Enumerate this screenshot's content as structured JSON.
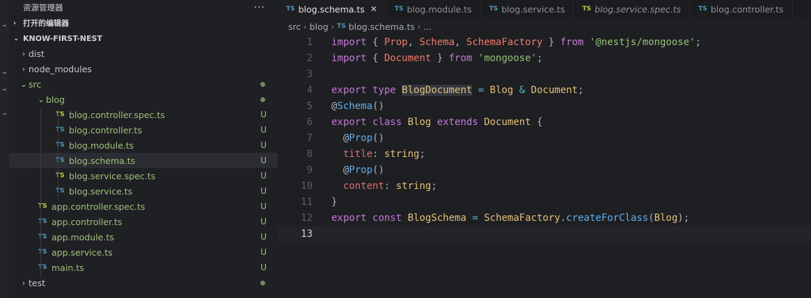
{
  "sidebar": {
    "title": "资源管理器",
    "more": "···",
    "open_editors": "打开的编辑器",
    "project": "KNOW-FIRST-NEST",
    "tree": [
      {
        "label": "dist",
        "type": "folder",
        "chev": "›",
        "depth": 0,
        "style": "plain"
      },
      {
        "label": "node_modules",
        "type": "folder",
        "chev": "›",
        "depth": 0,
        "style": "plain"
      },
      {
        "label": "src",
        "type": "folder",
        "chev": "⌄",
        "depth": 0,
        "style": "green",
        "dot": true
      },
      {
        "label": "blog",
        "type": "folder",
        "chev": "⌄",
        "depth": 1,
        "style": "green",
        "dot": true
      },
      {
        "label": "blog.controller.spec.ts",
        "type": "file",
        "depth": 2,
        "ts": "TS",
        "tsColor": "yellow",
        "git": "U"
      },
      {
        "label": "blog.controller.ts",
        "type": "file",
        "depth": 2,
        "ts": "TS",
        "tsColor": "blue",
        "git": "U"
      },
      {
        "label": "blog.module.ts",
        "type": "file",
        "depth": 2,
        "ts": "TS",
        "tsColor": "blue",
        "git": "U"
      },
      {
        "label": "blog.schema.ts",
        "type": "file",
        "depth": 2,
        "ts": "TS",
        "tsColor": "blue",
        "git": "U",
        "selected": true
      },
      {
        "label": "blog.service.spec.ts",
        "type": "file",
        "depth": 2,
        "ts": "TS",
        "tsColor": "yellow",
        "git": "U"
      },
      {
        "label": "blog.service.ts",
        "type": "file",
        "depth": 2,
        "ts": "TS",
        "tsColor": "blue",
        "git": "U"
      },
      {
        "label": "app.controller.spec.ts",
        "type": "file",
        "depth": 1,
        "ts": "TS",
        "tsColor": "yellow",
        "git": "U"
      },
      {
        "label": "app.controller.ts",
        "type": "file",
        "depth": 1,
        "ts": "TS",
        "tsColor": "blue",
        "git": "U"
      },
      {
        "label": "app.module.ts",
        "type": "file",
        "depth": 1,
        "ts": "TS",
        "tsColor": "blue",
        "git": "U"
      },
      {
        "label": "app.service.ts",
        "type": "file",
        "depth": 1,
        "ts": "TS",
        "tsColor": "blue",
        "git": "U"
      },
      {
        "label": "main.ts",
        "type": "file",
        "depth": 1,
        "ts": "TS",
        "tsColor": "blue",
        "git": "U"
      },
      {
        "label": "test",
        "type": "folder",
        "chev": "›",
        "depth": 0,
        "style": "plain",
        "dot": true
      }
    ]
  },
  "tabs": [
    {
      "label": "blog.schema.ts",
      "ts": "TS",
      "tsColor": "blue",
      "active": true,
      "close": "✕"
    },
    {
      "label": "blog.module.ts",
      "ts": "TS",
      "tsColor": "blue"
    },
    {
      "label": "blog.service.ts",
      "ts": "TS",
      "tsColor": "blue"
    },
    {
      "label": "blog.service.spec.ts",
      "ts": "TS",
      "tsColor": "yellow",
      "italic": true
    },
    {
      "label": "blog.controller.ts",
      "ts": "TS",
      "tsColor": "blue"
    }
  ],
  "breadcrumb": {
    "parts": [
      "src",
      "blog"
    ],
    "file_icon": "TS",
    "file": "blog.schema.ts",
    "tail": "..."
  },
  "code": {
    "current_line": 13,
    "lines": [
      [
        [
          "k",
          "import"
        ],
        [
          "p",
          " { "
        ],
        [
          "imp",
          "Prop"
        ],
        [
          "p",
          ", "
        ],
        [
          "imp",
          "Schema"
        ],
        [
          "p",
          ", "
        ],
        [
          "imp",
          "SchemaFactory"
        ],
        [
          "p",
          " } "
        ],
        [
          "k",
          "from"
        ],
        [
          "p",
          " "
        ],
        [
          "str",
          "'@nestjs/mongoose'"
        ],
        [
          "p",
          ";"
        ]
      ],
      [
        [
          "k",
          "import"
        ],
        [
          "p",
          " { "
        ],
        [
          "imp",
          "Document"
        ],
        [
          "p",
          " } "
        ],
        [
          "k",
          "from"
        ],
        [
          "p",
          " "
        ],
        [
          "str",
          "'mongoose'"
        ],
        [
          "p",
          ";"
        ]
      ],
      [],
      [
        [
          "k",
          "export"
        ],
        [
          "p",
          " "
        ],
        [
          "k",
          "type"
        ],
        [
          "p",
          " "
        ],
        [
          "hl",
          "BlogDocument"
        ],
        [
          "p",
          " "
        ],
        [
          "op",
          "="
        ],
        [
          "p",
          " "
        ],
        [
          "cls",
          "Blog"
        ],
        [
          "p",
          " "
        ],
        [
          "op",
          "&"
        ],
        [
          "p",
          " "
        ],
        [
          "cls",
          "Document"
        ],
        [
          "p",
          ";"
        ]
      ],
      [
        [
          "p",
          "@"
        ],
        [
          "fn",
          "Schema"
        ],
        [
          "p",
          "()"
        ]
      ],
      [
        [
          "k",
          "export"
        ],
        [
          "p",
          " "
        ],
        [
          "k",
          "class"
        ],
        [
          "p",
          " "
        ],
        [
          "cls",
          "Blog"
        ],
        [
          "p",
          " "
        ],
        [
          "k",
          "extends"
        ],
        [
          "p",
          " "
        ],
        [
          "cls",
          "Document"
        ],
        [
          "p",
          " {"
        ]
      ],
      [
        [
          "p",
          "  @"
        ],
        [
          "fn",
          "Prop"
        ],
        [
          "p",
          "()"
        ]
      ],
      [
        [
          "p",
          "  "
        ],
        [
          "prop",
          "title"
        ],
        [
          "p",
          ": "
        ],
        [
          "cls",
          "string"
        ],
        [
          "p",
          ";"
        ]
      ],
      [
        [
          "p",
          "  @"
        ],
        [
          "fn",
          "Prop"
        ],
        [
          "p",
          "()"
        ]
      ],
      [
        [
          "p",
          "  "
        ],
        [
          "prop",
          "content"
        ],
        [
          "p",
          ": "
        ],
        [
          "cls",
          "string"
        ],
        [
          "p",
          ";"
        ]
      ],
      [
        [
          "p",
          "}"
        ]
      ],
      [
        [
          "k",
          "export"
        ],
        [
          "p",
          " "
        ],
        [
          "k",
          "const"
        ],
        [
          "p",
          " "
        ],
        [
          "cls",
          "BlogSchema"
        ],
        [
          "p",
          " "
        ],
        [
          "op",
          "="
        ],
        [
          "p",
          " "
        ],
        [
          "cls",
          "SchemaFactory"
        ],
        [
          "p",
          "."
        ],
        [
          "fn",
          "createForClass"
        ],
        [
          "p",
          "("
        ],
        [
          "cls",
          "Blog"
        ],
        [
          "p",
          ");"
        ]
      ],
      []
    ]
  }
}
